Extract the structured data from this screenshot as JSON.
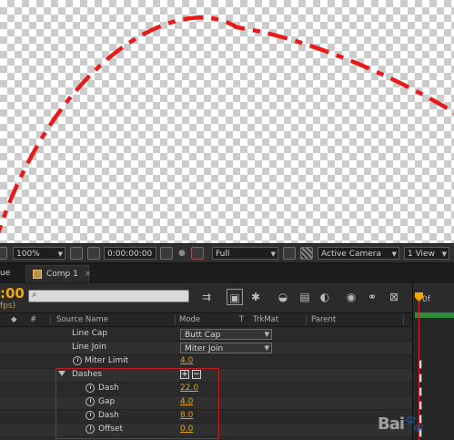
{
  "viewer": {
    "stroke_color": "#e81a1a",
    "background": "transparency-checkerboard"
  },
  "viewer_bar": {
    "magnification": "100%",
    "timecode": "0:00:00:00",
    "resolution": "Full",
    "camera": "Active Camera",
    "view_layout": "1 View",
    "icons": [
      "region-of-interest-icon",
      "snapshot-camera-icon",
      "show-snapshot-icon",
      "color-channel-icon",
      "transparency-grid-icon"
    ]
  },
  "tabs": {
    "left_fragment": "ue",
    "active_comp": "Comp 1",
    "close_glyph": "×"
  },
  "timeline_toolbar": {
    "current_time": ":00",
    "fps_fragment": "fps)",
    "search_placeholder": "",
    "search_glyph": "⌕",
    "tools": [
      "composition-mini-flowchart-icon",
      "live-update-icon",
      "draft-3d-icon",
      "hide-shy-layers-icon",
      "frame-blending-icon",
      "motion-blur-icon",
      "graph-editor-icon",
      "brainstorm-icon",
      "auto-keyframe-icon",
      "layer-switches-icon"
    ]
  },
  "columns": {
    "hash": "#",
    "source_name": "Source Name",
    "mode": "Mode",
    "t": "T",
    "trkmat": "TrkMat",
    "parent": "Parent"
  },
  "rows": [
    {
      "label": "Line Cap",
      "dropdown": "Butt Cap"
    },
    {
      "label": "Line Join",
      "dropdown": "Miter Join"
    },
    {
      "label": "Miter Limit",
      "value": "4.0"
    },
    {
      "label": "Dashes"
    },
    {
      "label": "Dash",
      "value": "22.0"
    },
    {
      "label": "Gap",
      "value": "4.0"
    },
    {
      "label": "Dash",
      "value": "8.0"
    },
    {
      "label": "Offset",
      "value": "0.0"
    }
  ],
  "dashes_controls": {
    "add": "+",
    "remove": "−"
  },
  "ruler": {
    "start_label": "0f"
  },
  "colors": {
    "accent_timecode": "#f0a800",
    "value_orange": "#e3a316",
    "highlight_box": "#c41c1c",
    "playhead": "#d8232a"
  }
}
